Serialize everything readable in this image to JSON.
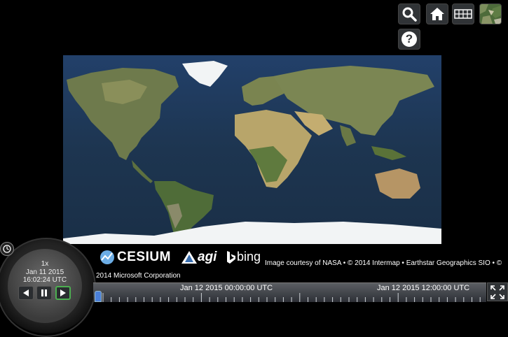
{
  "toolbar": {
    "search_icon": "search-icon",
    "home_icon": "home-icon",
    "scene_mode_icon": "columbus-view-icon",
    "base_layer_icon": "base-layer-picker-icon",
    "help_label": "?"
  },
  "animation": {
    "speed": "1x",
    "date": "Jan 11 2015",
    "time": "16:02:24 UTC"
  },
  "credits": {
    "cesium": "CESIUM",
    "agi": "agi",
    "bing": "bing",
    "text": "Image courtesy of NASA • © 2014 Intermap • Earthstar Geographics SIO • © 2014 Microsoft Corporation"
  },
  "timeline": {
    "label_1": "Jan 12 2015 00:00:00 UTC",
    "label_2": "Jan 12 2015 12:00:00 UTC"
  },
  "colors": {
    "background": "#000000",
    "button": "#303336",
    "play_active": "#4caf50",
    "ocean": "#1d3550",
    "land": "#6b7d4a",
    "ice": "#f2f4f5"
  }
}
